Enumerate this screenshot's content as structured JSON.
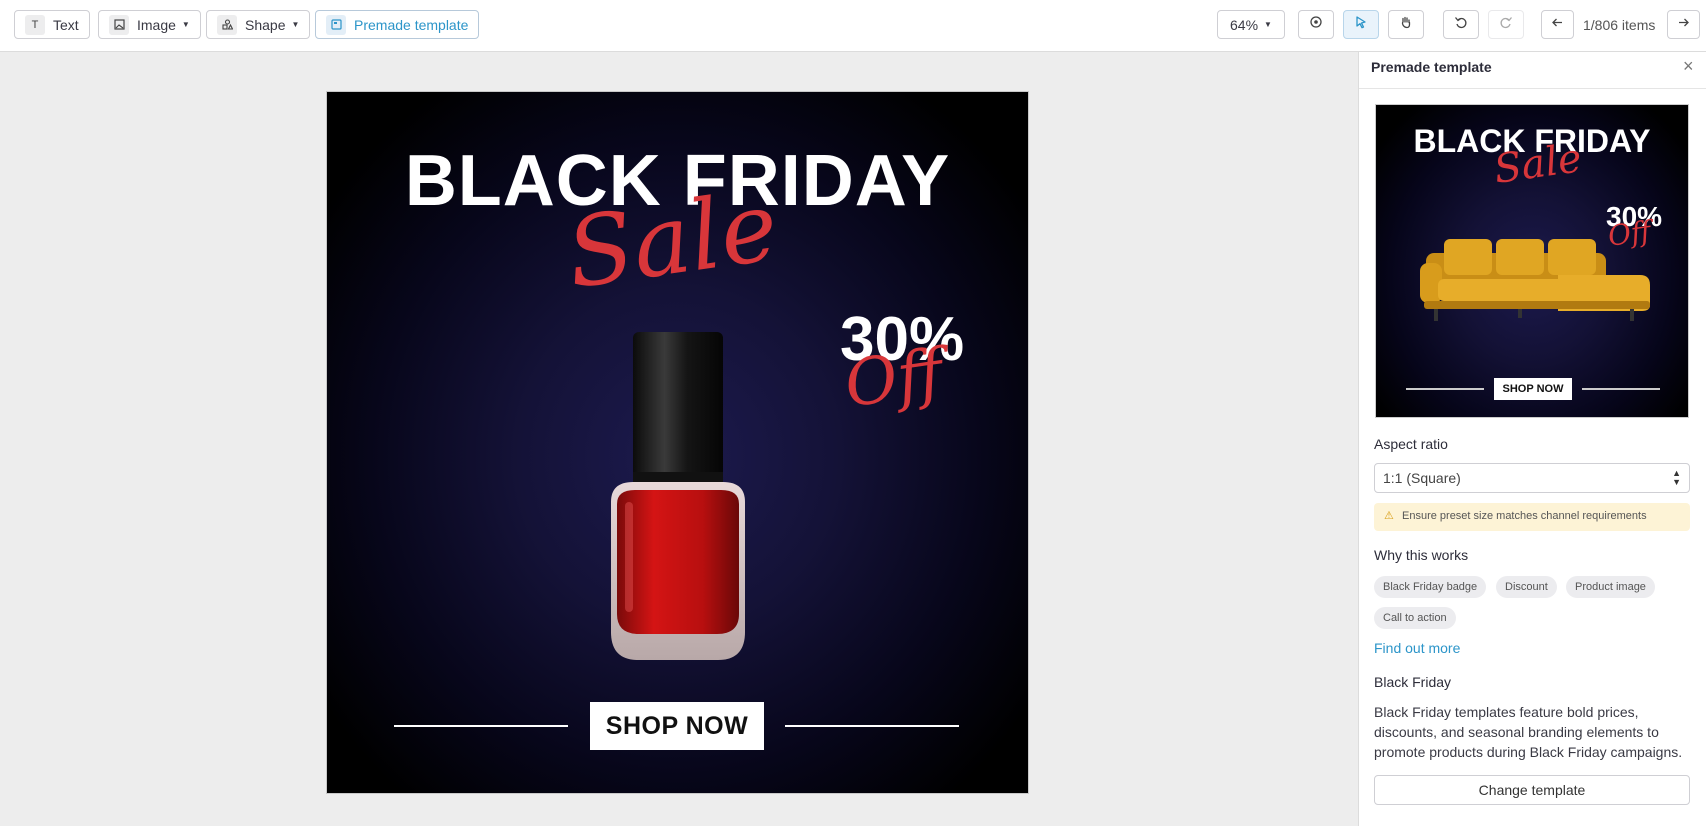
{
  "toolbar": {
    "text_label": "Text",
    "image_label": "Image",
    "shape_label": "Shape",
    "template_label": "Premade template",
    "zoom": "64%",
    "items": "1/806 items"
  },
  "canvas": {
    "title": "BLACK FRIDAY",
    "sale": "Sale",
    "percent": "30%",
    "off": "Off",
    "cta": "SHOP NOW"
  },
  "panel": {
    "title": "Premade template",
    "thumb": {
      "title": "BLACK FRIDAY",
      "sale": "Sale",
      "percent": "30%",
      "off": "Off",
      "cta": "SHOP NOW"
    },
    "aspect_label": "Aspect ratio",
    "aspect_value": "1:1 (Square)",
    "warning": "Ensure preset size matches channel requirements",
    "why_label": "Why this works",
    "chips": [
      "Black Friday badge",
      "Discount",
      "Product image",
      "Call to action"
    ],
    "find_more": "Find out more",
    "template_name": "Black Friday",
    "description": "Black Friday templates feature bold prices, discounts, and seasonal branding elements to promote products during Black Friday campaigns.",
    "change_button": "Change template"
  },
  "colors": {
    "accent": "#2c95c9",
    "sale_red": "#d8363a",
    "warning_bg": "#fdf3d6"
  },
  "icons": [
    "text-icon",
    "image-icon",
    "shape-icon",
    "template-icon",
    "target-icon",
    "pointer-icon",
    "hand-icon",
    "undo-icon",
    "redo-icon",
    "arrow-left-icon",
    "arrow-right-icon",
    "close-icon",
    "warning-icon"
  ]
}
